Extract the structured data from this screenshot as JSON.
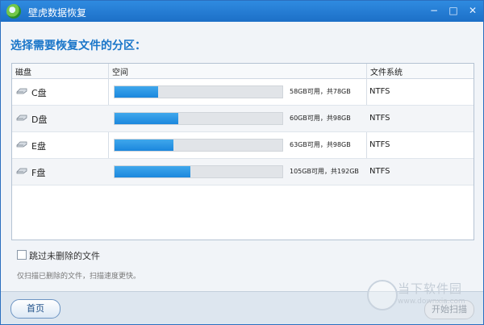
{
  "window": {
    "title": "壁虎数据恢复",
    "controls": {
      "minimize": "−",
      "maximize": "□",
      "close": "✕"
    }
  },
  "heading": "选择需要恢复文件的分区：",
  "table": {
    "columns": {
      "disk": "磁盘",
      "space": "空间",
      "fs": "文件系统"
    },
    "rows": [
      {
        "disk": "C盘",
        "used_fraction": 0.26,
        "size": "58GB可用，共78GB",
        "fs": "NTFS"
      },
      {
        "disk": "D盘",
        "used_fraction": 0.38,
        "size": "60GB可用，共98GB",
        "fs": "NTFS"
      },
      {
        "disk": "E盘",
        "used_fraction": 0.35,
        "size": "63GB可用，共98GB",
        "fs": "NTFS"
      },
      {
        "disk": "F盘",
        "used_fraction": 0.45,
        "size": "105GB可用，共192GB",
        "fs": "NTFS"
      }
    ]
  },
  "option": {
    "label": "跳过未删除的文件",
    "checked": false
  },
  "hint": "仅扫描已删除的文件，扫描速度更快。",
  "footer": {
    "home_label": "首页",
    "next_label": "开始扫描"
  },
  "watermark": {
    "title": "当下软件园",
    "url": "www.downxia.com"
  },
  "colors": {
    "accent": "#1a76c9",
    "bar": "#1b87dd",
    "titlebar": "#1c6fc7"
  }
}
